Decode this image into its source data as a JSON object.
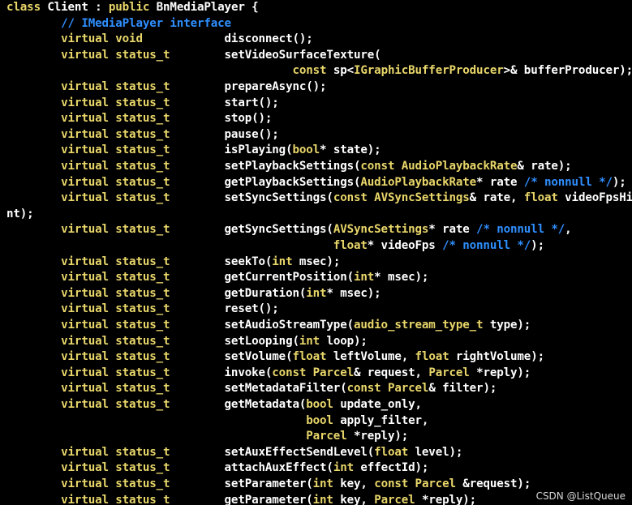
{
  "code_lines": [
    [
      {
        "t": "class ",
        "c": "kw"
      },
      {
        "t": "Client : ",
        "c": "tx"
      },
      {
        "t": "public ",
        "c": "kw"
      },
      {
        "t": "BnMediaPlayer {",
        "c": "tx"
      }
    ],
    [
      {
        "t": "        ",
        "c": "tx"
      },
      {
        "t": "// IMediaPlayer interface",
        "c": "cm"
      }
    ],
    [
      {
        "t": "        ",
        "c": "tx"
      },
      {
        "t": "virtual void",
        "c": "kw"
      },
      {
        "t": "            disconnect();",
        "c": "tx"
      }
    ],
    [
      {
        "t": "        ",
        "c": "tx"
      },
      {
        "t": "virtual status_t",
        "c": "kw"
      },
      {
        "t": "        setVideoSurfaceTexture(",
        "c": "tx"
      }
    ],
    [
      {
        "t": "                                          ",
        "c": "tx"
      },
      {
        "t": "const ",
        "c": "kw"
      },
      {
        "t": "sp<",
        "c": "tx"
      },
      {
        "t": "IGraphicBufferProducer",
        "c": "ty"
      },
      {
        "t": ">& bufferProducer);",
        "c": "tx"
      }
    ],
    [
      {
        "t": "        ",
        "c": "tx"
      },
      {
        "t": "virtual status_t",
        "c": "kw"
      },
      {
        "t": "        prepareAsync();",
        "c": "tx"
      }
    ],
    [
      {
        "t": "        ",
        "c": "tx"
      },
      {
        "t": "virtual status_t",
        "c": "kw"
      },
      {
        "t": "        start();",
        "c": "tx"
      }
    ],
    [
      {
        "t": "        ",
        "c": "tx"
      },
      {
        "t": "virtual status_t",
        "c": "kw"
      },
      {
        "t": "        stop();",
        "c": "tx"
      }
    ],
    [
      {
        "t": "        ",
        "c": "tx"
      },
      {
        "t": "virtual status_t",
        "c": "kw"
      },
      {
        "t": "        pause();",
        "c": "tx"
      }
    ],
    [
      {
        "t": "        ",
        "c": "tx"
      },
      {
        "t": "virtual status_t",
        "c": "kw"
      },
      {
        "t": "        isPlaying(",
        "c": "tx"
      },
      {
        "t": "bool",
        "c": "kw"
      },
      {
        "t": "* state);",
        "c": "tx"
      }
    ],
    [
      {
        "t": "        ",
        "c": "tx"
      },
      {
        "t": "virtual status_t",
        "c": "kw"
      },
      {
        "t": "        setPlaybackSettings(",
        "c": "tx"
      },
      {
        "t": "const ",
        "c": "kw"
      },
      {
        "t": "AudioPlaybackRate",
        "c": "ty"
      },
      {
        "t": "& rate);",
        "c": "tx"
      }
    ],
    [
      {
        "t": "        ",
        "c": "tx"
      },
      {
        "t": "virtual status_t",
        "c": "kw"
      },
      {
        "t": "        getPlaybackSettings(",
        "c": "tx"
      },
      {
        "t": "AudioPlaybackRate",
        "c": "ty"
      },
      {
        "t": "* rate ",
        "c": "tx"
      },
      {
        "t": "/* nonnull */",
        "c": "cm"
      },
      {
        "t": ");",
        "c": "tx"
      }
    ],
    [
      {
        "t": "        ",
        "c": "tx"
      },
      {
        "t": "virtual status_t",
        "c": "kw"
      },
      {
        "t": "        setSyncSettings(",
        "c": "tx"
      },
      {
        "t": "const ",
        "c": "kw"
      },
      {
        "t": "AVSyncSettings",
        "c": "ty"
      },
      {
        "t": "& rate, ",
        "c": "tx"
      },
      {
        "t": "float ",
        "c": "kw"
      },
      {
        "t": "videoFpsHi",
        "c": "tx"
      }
    ],
    [
      {
        "t": "nt);",
        "c": "tx"
      }
    ],
    [
      {
        "t": "        ",
        "c": "tx"
      },
      {
        "t": "virtual status_t",
        "c": "kw"
      },
      {
        "t": "        getSyncSettings(",
        "c": "tx"
      },
      {
        "t": "AVSyncSettings",
        "c": "ty"
      },
      {
        "t": "* rate ",
        "c": "tx"
      },
      {
        "t": "/* nonnull */",
        "c": "cm"
      },
      {
        "t": ",",
        "c": "tx"
      }
    ],
    [
      {
        "t": "                                                ",
        "c": "tx"
      },
      {
        "t": "float",
        "c": "kw"
      },
      {
        "t": "* videoFps ",
        "c": "tx"
      },
      {
        "t": "/* nonnull */",
        "c": "cm"
      },
      {
        "t": ");",
        "c": "tx"
      }
    ],
    [
      {
        "t": "        ",
        "c": "tx"
      },
      {
        "t": "virtual status_t",
        "c": "kw"
      },
      {
        "t": "        seekTo(",
        "c": "tx"
      },
      {
        "t": "int ",
        "c": "kw"
      },
      {
        "t": "msec);",
        "c": "tx"
      }
    ],
    [
      {
        "t": "        ",
        "c": "tx"
      },
      {
        "t": "virtual status_t",
        "c": "kw"
      },
      {
        "t": "        getCurrentPosition(",
        "c": "tx"
      },
      {
        "t": "int",
        "c": "kw"
      },
      {
        "t": "* msec);",
        "c": "tx"
      }
    ],
    [
      {
        "t": "        ",
        "c": "tx"
      },
      {
        "t": "virtual status_t",
        "c": "kw"
      },
      {
        "t": "        getDuration(",
        "c": "tx"
      },
      {
        "t": "int",
        "c": "kw"
      },
      {
        "t": "* msec);",
        "c": "tx"
      }
    ],
    [
      {
        "t": "        ",
        "c": "tx"
      },
      {
        "t": "virtual status_t",
        "c": "kw"
      },
      {
        "t": "        reset();",
        "c": "tx"
      }
    ],
    [
      {
        "t": "        ",
        "c": "tx"
      },
      {
        "t": "virtual status_t",
        "c": "kw"
      },
      {
        "t": "        setAudioStreamType(",
        "c": "tx"
      },
      {
        "t": "audio_stream_type_t",
        "c": "ty"
      },
      {
        "t": " type);",
        "c": "tx"
      }
    ],
    [
      {
        "t": "        ",
        "c": "tx"
      },
      {
        "t": "virtual status_t",
        "c": "kw"
      },
      {
        "t": "        setLooping(",
        "c": "tx"
      },
      {
        "t": "int ",
        "c": "kw"
      },
      {
        "t": "loop);",
        "c": "tx"
      }
    ],
    [
      {
        "t": "        ",
        "c": "tx"
      },
      {
        "t": "virtual status_t",
        "c": "kw"
      },
      {
        "t": "        setVolume(",
        "c": "tx"
      },
      {
        "t": "float ",
        "c": "kw"
      },
      {
        "t": "leftVolume, ",
        "c": "tx"
      },
      {
        "t": "float ",
        "c": "kw"
      },
      {
        "t": "rightVolume);",
        "c": "tx"
      }
    ],
    [
      {
        "t": "        ",
        "c": "tx"
      },
      {
        "t": "virtual status_t",
        "c": "kw"
      },
      {
        "t": "        invoke(",
        "c": "tx"
      },
      {
        "t": "const ",
        "c": "kw"
      },
      {
        "t": "Parcel",
        "c": "ty"
      },
      {
        "t": "& request, ",
        "c": "tx"
      },
      {
        "t": "Parcel",
        "c": "ty"
      },
      {
        "t": " *reply);",
        "c": "tx"
      }
    ],
    [
      {
        "t": "        ",
        "c": "tx"
      },
      {
        "t": "virtual status_t",
        "c": "kw"
      },
      {
        "t": "        setMetadataFilter(",
        "c": "tx"
      },
      {
        "t": "const ",
        "c": "kw"
      },
      {
        "t": "Parcel",
        "c": "ty"
      },
      {
        "t": "& filter);",
        "c": "tx"
      }
    ],
    [
      {
        "t": "        ",
        "c": "tx"
      },
      {
        "t": "virtual status_t",
        "c": "kw"
      },
      {
        "t": "        getMetadata(",
        "c": "tx"
      },
      {
        "t": "bool ",
        "c": "kw"
      },
      {
        "t": "update_only,",
        "c": "tx"
      }
    ],
    [
      {
        "t": "                                            ",
        "c": "tx"
      },
      {
        "t": "bool ",
        "c": "kw"
      },
      {
        "t": "apply_filter,",
        "c": "tx"
      }
    ],
    [
      {
        "t": "                                            ",
        "c": "tx"
      },
      {
        "t": "Parcel",
        "c": "ty"
      },
      {
        "t": " *reply);",
        "c": "tx"
      }
    ],
    [
      {
        "t": "        ",
        "c": "tx"
      },
      {
        "t": "virtual status_t",
        "c": "kw"
      },
      {
        "t": "        setAuxEffectSendLevel(",
        "c": "tx"
      },
      {
        "t": "float ",
        "c": "kw"
      },
      {
        "t": "level);",
        "c": "tx"
      }
    ],
    [
      {
        "t": "        ",
        "c": "tx"
      },
      {
        "t": "virtual status_t",
        "c": "kw"
      },
      {
        "t": "        attachAuxEffect(",
        "c": "tx"
      },
      {
        "t": "int ",
        "c": "kw"
      },
      {
        "t": "effectId);",
        "c": "tx"
      }
    ],
    [
      {
        "t": "        ",
        "c": "tx"
      },
      {
        "t": "virtual status_t",
        "c": "kw"
      },
      {
        "t": "        setParameter(",
        "c": "tx"
      },
      {
        "t": "int ",
        "c": "kw"
      },
      {
        "t": "key, ",
        "c": "tx"
      },
      {
        "t": "const ",
        "c": "kw"
      },
      {
        "t": "Parcel",
        "c": "ty"
      },
      {
        "t": " &request);",
        "c": "tx"
      }
    ],
    [
      {
        "t": "        ",
        "c": "tx"
      },
      {
        "t": "virtual status_t",
        "c": "kw"
      },
      {
        "t": "        getParameter(",
        "c": "tx"
      },
      {
        "t": "int ",
        "c": "kw"
      },
      {
        "t": "key, ",
        "c": "tx"
      },
      {
        "t": "Parcel",
        "c": "ty"
      },
      {
        "t": " *reply);",
        "c": "tx"
      }
    ]
  ],
  "colors": {
    "background": "#000000",
    "keyword": "#e8d66a",
    "comment": "#2f8fff",
    "text": "#ffffff"
  },
  "watermark": "CSDN @ListQueue"
}
